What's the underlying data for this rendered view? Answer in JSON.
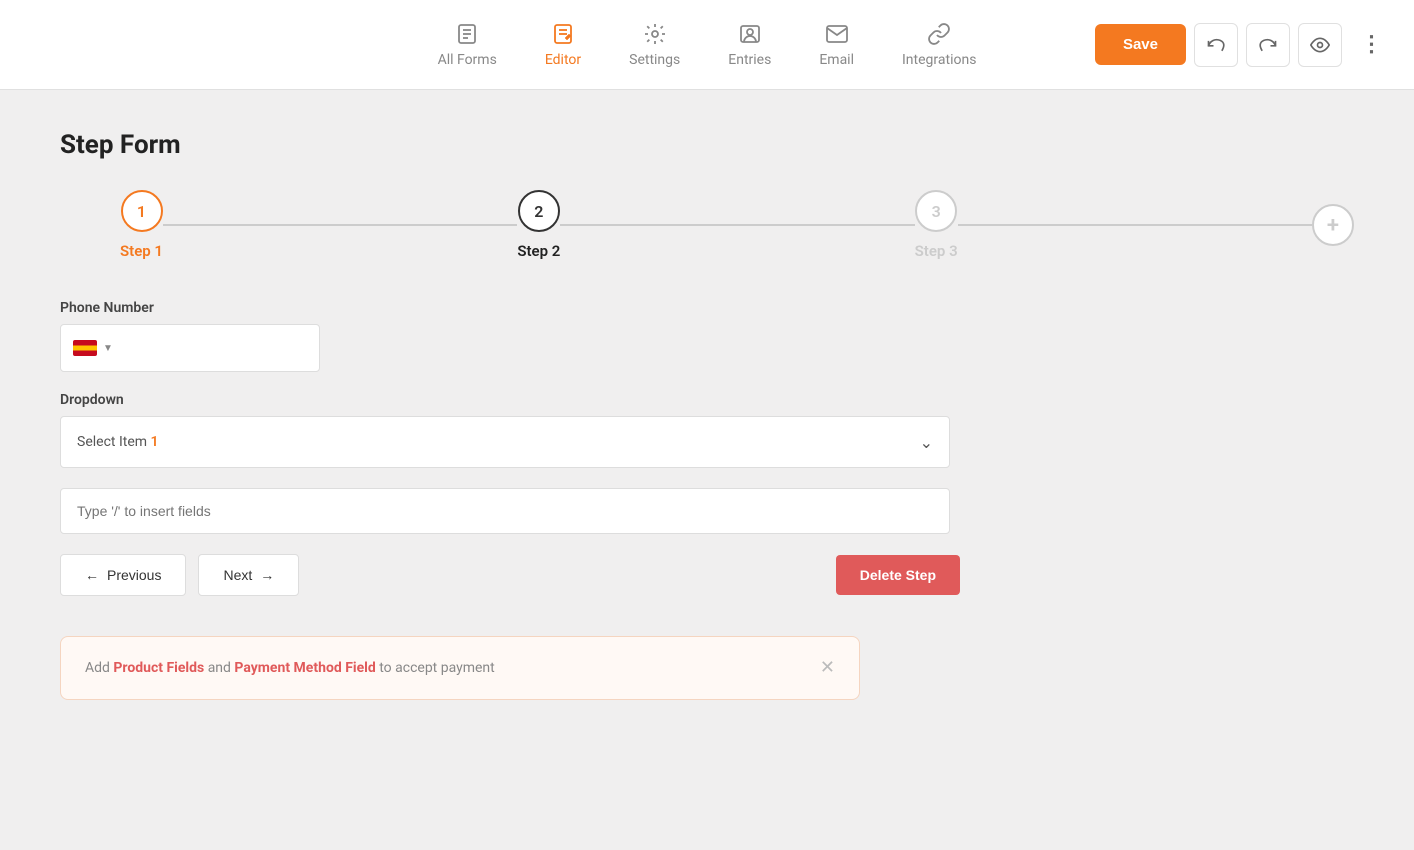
{
  "nav": {
    "items": [
      {
        "id": "all-forms",
        "label": "All Forms",
        "icon": "form",
        "active": false
      },
      {
        "id": "editor",
        "label": "Editor",
        "icon": "editor",
        "active": true
      },
      {
        "id": "settings",
        "label": "Settings",
        "icon": "settings",
        "active": false
      },
      {
        "id": "entries",
        "label": "Entries",
        "icon": "entries",
        "active": false
      },
      {
        "id": "email",
        "label": "Email",
        "icon": "email",
        "active": false
      },
      {
        "id": "integrations",
        "label": "Integrations",
        "icon": "integrations",
        "active": false
      }
    ],
    "save_label": "Save",
    "online_dot_color": "#3cb043"
  },
  "page": {
    "title": "Step Form"
  },
  "steps": [
    {
      "number": "1",
      "label": "Step 1",
      "state": "active"
    },
    {
      "number": "2",
      "label": "Step 2",
      "state": "done"
    },
    {
      "number": "3",
      "label": "Step 3",
      "state": "inactive"
    }
  ],
  "form": {
    "phone_label": "Phone Number",
    "phone_placeholder": "",
    "dropdown_label": "Dropdown",
    "dropdown_placeholder": "Select Item",
    "dropdown_number": "1",
    "insert_placeholder": "Type '/' to insert fields"
  },
  "buttons": {
    "previous": "Previous",
    "next": "Next",
    "delete_step": "Delete Step"
  },
  "banner": {
    "prefix_text": "Add ",
    "product_fields": "Product Fields",
    "and_text": " and ",
    "payment_field": "Payment Method Field",
    "suffix_text": " to accept payment"
  }
}
